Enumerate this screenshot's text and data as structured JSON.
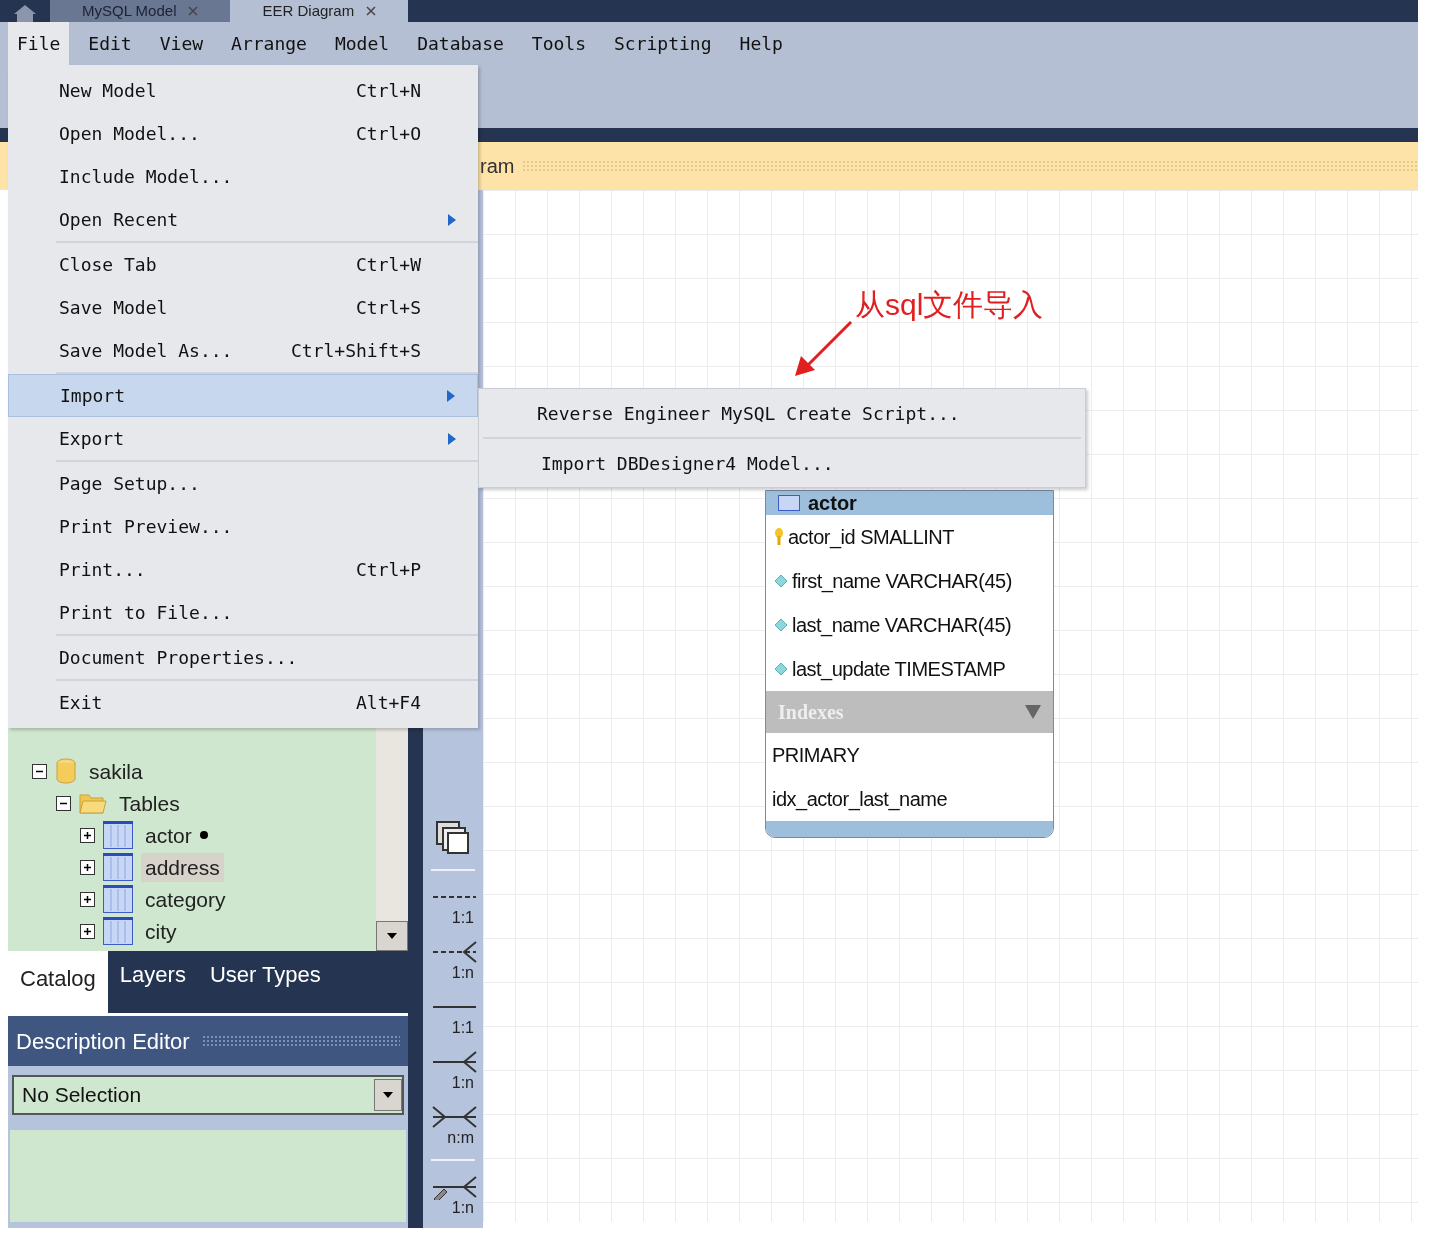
{
  "doc_tabs": [
    {
      "label": "MySQL Model",
      "selected": false
    },
    {
      "label": "EER Diagram",
      "selected": true
    }
  ],
  "menubar": [
    {
      "label": "File",
      "selected": true
    },
    {
      "label": "Edit",
      "selected": false
    },
    {
      "label": "View",
      "selected": false
    },
    {
      "label": "Arrange",
      "selected": false
    },
    {
      "label": "Model",
      "selected": false
    },
    {
      "label": "Database",
      "selected": false
    },
    {
      "label": "Tools",
      "selected": false
    },
    {
      "label": "Scripting",
      "selected": false
    },
    {
      "label": "Help",
      "selected": false
    }
  ],
  "diagram_strip": {
    "title": "ram"
  },
  "file_menu": [
    [
      {
        "label": "New Model",
        "shortcut": "Ctrl+N",
        "submenu": false,
        "selected": false
      },
      {
        "label": "Open Model...",
        "shortcut": "Ctrl+O",
        "submenu": false,
        "selected": false
      },
      {
        "label": "Include Model...",
        "submenu": false,
        "selected": false
      },
      {
        "label": "Open Recent",
        "submenu": true,
        "selected": false
      }
    ],
    [
      {
        "label": "Close Tab",
        "shortcut": "Ctrl+W",
        "submenu": false,
        "selected": false
      },
      {
        "label": "Save Model",
        "shortcut": "Ctrl+S",
        "submenu": false,
        "selected": false
      },
      {
        "label": "Save Model As...",
        "shortcut": "Ctrl+Shift+S",
        "submenu": false,
        "selected": false
      }
    ],
    [
      {
        "label": "Import",
        "submenu": true,
        "selected": true
      },
      {
        "label": "Export",
        "submenu": true,
        "selected": false
      }
    ],
    [
      {
        "label": "Page Setup...",
        "submenu": false,
        "selected": false
      },
      {
        "label": "Print Preview...",
        "submenu": false,
        "selected": false
      },
      {
        "label": "Print...",
        "shortcut": "Ctrl+P",
        "submenu": false,
        "selected": false
      },
      {
        "label": "Print to File...",
        "submenu": false,
        "selected": false
      }
    ],
    [
      {
        "label": "Document Properties...",
        "submenu": false,
        "selected": false
      }
    ],
    [
      {
        "label": "Exit",
        "shortcut": "Alt+F4",
        "submenu": false,
        "selected": false
      }
    ]
  ],
  "import_submenu": [
    {
      "label": "Reverse Engineer MySQL Create Script..."
    },
    {
      "label": "Import DBDesigner4 Model..."
    }
  ],
  "annotation": {
    "text": "从sql文件导入"
  },
  "catalog_tree": [
    {
      "label": "sakila",
      "kind": "schema",
      "expanded": true,
      "selected": false,
      "children": [
        {
          "label": "Tables",
          "kind": "group",
          "expanded": true,
          "selected": false,
          "children": [
            {
              "label": "actor",
              "kind": "table",
              "expanded": false,
              "selected": false,
              "modified": true
            },
            {
              "label": "address",
              "kind": "table",
              "expanded": false,
              "selected": true,
              "modified": false
            },
            {
              "label": "category",
              "kind": "table",
              "expanded": false,
              "selected": false,
              "modified": false
            },
            {
              "label": "city",
              "kind": "table",
              "expanded": false,
              "selected": false,
              "modified": false
            }
          ]
        }
      ]
    }
  ],
  "panel_tabs": [
    {
      "label": "Catalog",
      "selected": true
    },
    {
      "label": "Layers",
      "selected": false
    },
    {
      "label": "User Types",
      "selected": false
    }
  ],
  "description_editor": {
    "title": "Description Editor",
    "select_value": "No Selection"
  },
  "palette": [
    {
      "label": "1:1",
      "kind": "dashed_one",
      "picker": false
    },
    {
      "label": "1:n",
      "kind": "dashed_many",
      "picker": false
    },
    {
      "label": "1:1",
      "kind": "solid_one",
      "picker": false
    },
    {
      "label": "1:n",
      "kind": "solid_many",
      "picker": false
    },
    {
      "label": "n:m",
      "kind": "solid_both",
      "picker": false
    },
    {
      "label": "1:n",
      "kind": "solid_many",
      "picker": true
    }
  ],
  "table": {
    "title": "actor",
    "columns": [
      {
        "name": "actor_id SMALLINT",
        "kind": "primary"
      },
      {
        "name": "first_name VARCHAR(45)",
        "kind": "column"
      },
      {
        "name": "last_name VARCHAR(45)",
        "kind": "column"
      },
      {
        "name": "last_update TIMESTAMP",
        "kind": "column"
      }
    ],
    "indexes_title": "Indexes",
    "indexes": [
      "PRIMARY",
      "idx_actor_last_name"
    ]
  }
}
